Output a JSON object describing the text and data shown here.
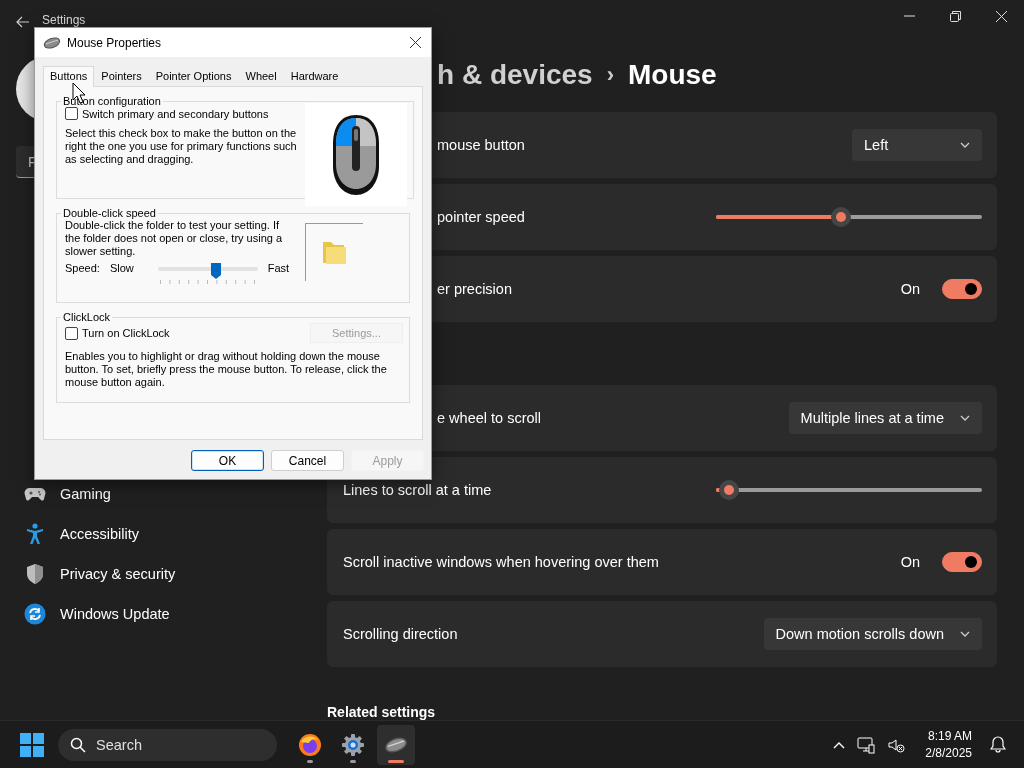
{
  "settings": {
    "title": "Settings",
    "search": {
      "placeholder": "F"
    },
    "sidebar": {
      "items": [
        {
          "label": "Gaming",
          "selected": false
        },
        {
          "label": "Accessibility",
          "selected": false
        },
        {
          "label": "Privacy & security",
          "selected": false
        },
        {
          "label": "Windows Update",
          "selected": false
        }
      ]
    },
    "breadcrumb": {
      "parent": "h & devices",
      "separator": "›",
      "current": "Mouse"
    },
    "groups": [
      {
        "rows": [
          {
            "kind": "dropdown",
            "label": "mouse button",
            "value": "Left"
          },
          {
            "kind": "slider",
            "label": "pointer speed",
            "level": 0.47
          },
          {
            "kind": "toggle",
            "label": "er precision",
            "state_label": "On",
            "on": true
          }
        ]
      },
      {
        "rows": [
          {
            "kind": "dropdown",
            "label": "e wheel to scroll",
            "value": "Multiple lines at a time"
          },
          {
            "kind": "slider",
            "label": "Lines to scroll at a time",
            "level": 0.05
          },
          {
            "kind": "toggle",
            "label": "Scroll inactive windows when hovering over them",
            "state_label": "On",
            "on": true
          },
          {
            "kind": "dropdown",
            "label": "Scrolling direction",
            "value": "Down motion scrolls down"
          }
        ]
      }
    ],
    "related_heading": "Related settings"
  },
  "dialog": {
    "title": "Mouse Properties",
    "tabs": [
      {
        "label": "Buttons",
        "selected": true
      },
      {
        "label": "Pointers",
        "selected": false
      },
      {
        "label": "Pointer Options",
        "selected": false
      },
      {
        "label": "Wheel",
        "selected": false
      },
      {
        "label": "Hardware",
        "selected": false
      }
    ],
    "button_configuration": {
      "legend": "Button configuration",
      "checkbox": {
        "label": "Switch primary and secondary buttons",
        "checked": false
      },
      "description": "Select this check box to make the button on the right the one you use for primary functions such as selecting and dragging."
    },
    "double_click_speed": {
      "legend": "Double-click speed",
      "description": "Double-click the folder to test your setting. If the folder does not open or close, try using a slower setting.",
      "speed_label": "Speed:",
      "slow_label": "Slow",
      "fast_label": "Fast",
      "level": 0.58
    },
    "clicklock": {
      "legend": "ClickLock",
      "checkbox": {
        "label": "Turn on ClickLock",
        "checked": false
      },
      "settings_button": {
        "label": "Settings...",
        "disabled": true
      },
      "description": "Enables you to highlight or drag without holding down the mouse button. To set, briefly press the mouse button. To release, click the mouse button again."
    },
    "buttons": [
      {
        "label": "OK",
        "default": true,
        "disabled": false
      },
      {
        "label": "Cancel",
        "default": false,
        "disabled": false
      },
      {
        "label": "Apply",
        "default": false,
        "disabled": true
      }
    ]
  },
  "taskbar": {
    "search": {
      "placeholder": "Search"
    },
    "apps": [
      {
        "selected": false
      },
      {
        "selected": false
      },
      {
        "selected": true
      }
    ],
    "clock": {
      "time": "8:19 AM",
      "date": "2/8/2025"
    }
  }
}
